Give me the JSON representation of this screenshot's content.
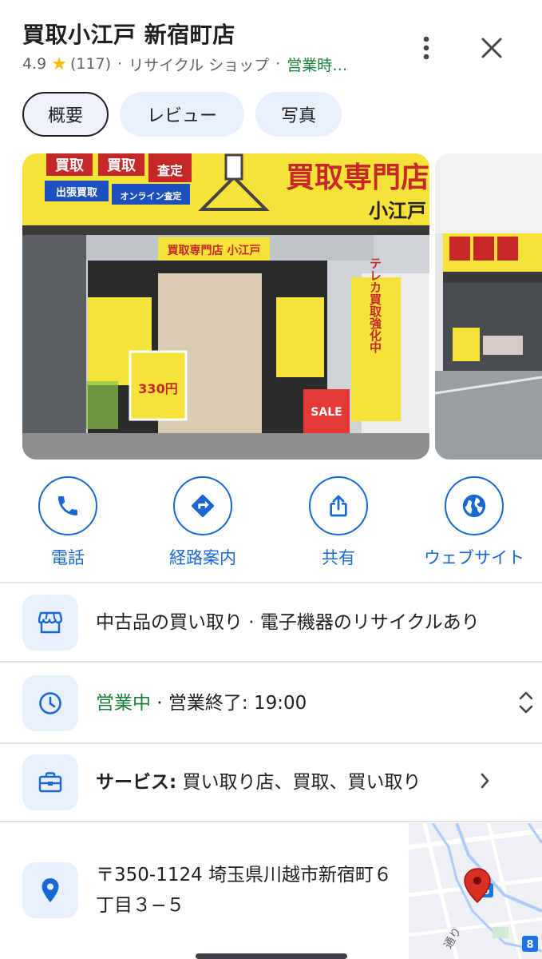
{
  "header": {
    "title": "買取小江戸 新宿町店",
    "rating": "4.9",
    "star": "★",
    "reviews": "(117)",
    "category": "リサイクル ショップ",
    "status": "営業時…",
    "separator": "·"
  },
  "tabs": [
    {
      "label": "概要",
      "active": true
    },
    {
      "label": "レビュー",
      "active": false
    },
    {
      "label": "写真",
      "active": false
    }
  ],
  "photo_signs": {
    "main_banner": "買取専門店",
    "main_banner_sub": "小江戸",
    "tag1": "買取",
    "tag2": "買取",
    "tag3": "査定",
    "tag4": "出張買取",
    "tag5": "オンライン査定",
    "door_sign": "買取専門店 小江戸",
    "flag": "テレカ買取強化中",
    "price": "330円",
    "sale": "SALE"
  },
  "actions": [
    {
      "label": "電話",
      "icon": "phone-icon"
    },
    {
      "label": "経路案内",
      "icon": "directions-icon"
    },
    {
      "label": "共有",
      "icon": "share-icon"
    },
    {
      "label": "ウェブサイト",
      "icon": "globe-icon"
    }
  ],
  "info": {
    "description": "中古品の買い取り · 電子機器のリサイクルあり",
    "hours_status": "営業中",
    "hours_detail": " · 営業終了: 19:00",
    "services_label": "サービス:",
    "services_value": " 買い取り店、買取、買い取り",
    "address": "〒350-1124 埼玉県川越市新宿町６丁目３−５"
  },
  "map": {
    "badge1": "6",
    "badge2": "8",
    "road_label": "通り"
  },
  "colors": {
    "accent": "#1967d2",
    "open_green": "#188038",
    "star": "#fbbc04",
    "chip_bg": "#e8f0fe"
  }
}
